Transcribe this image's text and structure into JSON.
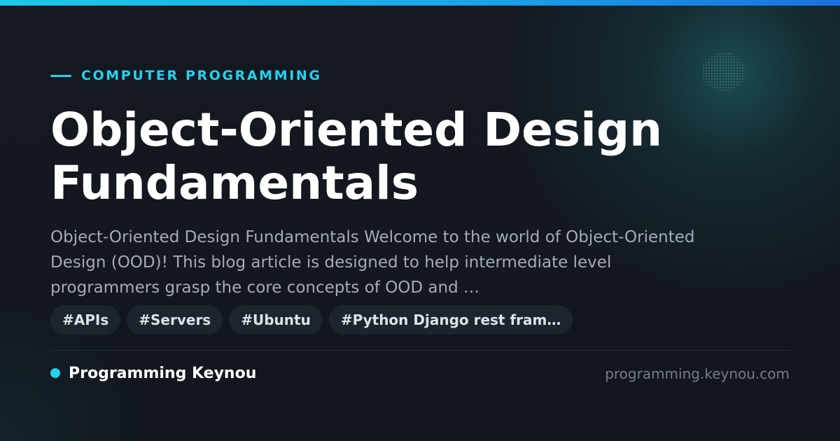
{
  "category": "COMPUTER PROGRAMMING",
  "title": "Object-Oriented Design Fundamentals",
  "description": "Object-Oriented Design Fundamentals Welcome to the world of Object-Oriented Design (OOD)! This blog article is designed to help intermediate level programmers grasp the core concepts of OOD and …",
  "tags": [
    "#APIs",
    "#Servers",
    "#Ubuntu",
    "#Python Django rest fram…"
  ],
  "brand": {
    "name": "Programming Keynou",
    "domain": "programming.keynou.com"
  },
  "colors": {
    "accent": "#22d3ee",
    "background": "#12161d",
    "title": "#ffffff",
    "description": "#a3acb8",
    "tag_background": "#1c242e",
    "domain_text": "#737d8a"
  }
}
